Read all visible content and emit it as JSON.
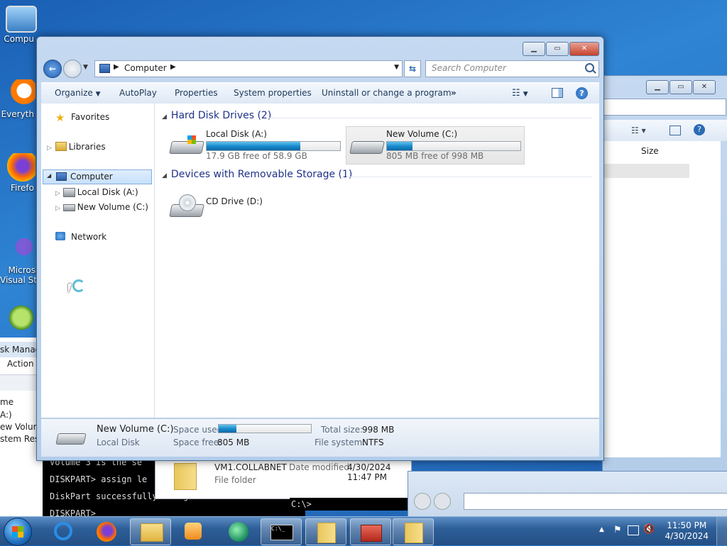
{
  "desktop": {
    "icons": [
      {
        "label": "Compu"
      },
      {
        "label": "Everyth"
      },
      {
        "label": "Firefo"
      },
      {
        "label": "Micros\nVisual St"
      },
      {
        "label": ""
      }
    ]
  },
  "background": {
    "disk_mgmt": {
      "title": "sk Manag",
      "menu_action": "Action",
      "col_name": "me",
      "rows": [
        "A:)",
        "ew Volum",
        "stem Res"
      ]
    },
    "explorer2": {
      "col_size": "Size"
    },
    "cmd_lines": [
      "Volume 3 is the se",
      "DISKPART> assign le",
      "DiskPart successfully assigned the driv",
      "DISKPART>"
    ],
    "cmd2_prompt": "C:\\>",
    "folder_item": {
      "name": "VM1.COLLABNET",
      "modified_label": "Date modified:",
      "modified": "4/30/2024 11:47 PM",
      "type": "File folder"
    }
  },
  "window": {
    "breadcrumb": "Computer",
    "search_placeholder": "Search Computer",
    "toolbar": {
      "organize": "Organize",
      "autoplay": "AutoPlay",
      "properties": "Properties",
      "system_properties": "System properties",
      "uninstall": "Uninstall or change a program",
      "more": "»"
    },
    "nav": {
      "favorites": "Favorites",
      "libraries": "Libraries",
      "computer": "Computer",
      "local_disk": "Local Disk (A:)",
      "new_volume": "New Volume (C:)",
      "network": "Network"
    },
    "groups": {
      "hdd": "Hard Disk Drives (2)",
      "removable": "Devices with Removable Storage (1)"
    },
    "drives": [
      {
        "name": "Local Disk (A:)",
        "free": "17.9 GB free of 58.9 GB",
        "used_fraction": 0.7
      },
      {
        "name": "New Volume (C:)",
        "free": "805 MB free of 998 MB",
        "used_fraction": 0.19
      }
    ],
    "cd": {
      "name": "CD Drive (D:)"
    },
    "details": {
      "name": "New Volume (C:)",
      "type": "Local Disk",
      "space_used_label": "Space used:",
      "space_used_fraction": 0.19,
      "space_free_label": "Space free:",
      "space_free": "805 MB",
      "total_size_label": "Total size:",
      "total_size": "998 MB",
      "file_system_label": "File system:",
      "file_system": "NTFS"
    }
  },
  "taskbar": {
    "time": "11:50 PM",
    "date": "4/30/2024"
  },
  "colors": {
    "accent": "#1f6fc1",
    "bar_fill": "#1687c9",
    "group_header": "#1e3287"
  }
}
